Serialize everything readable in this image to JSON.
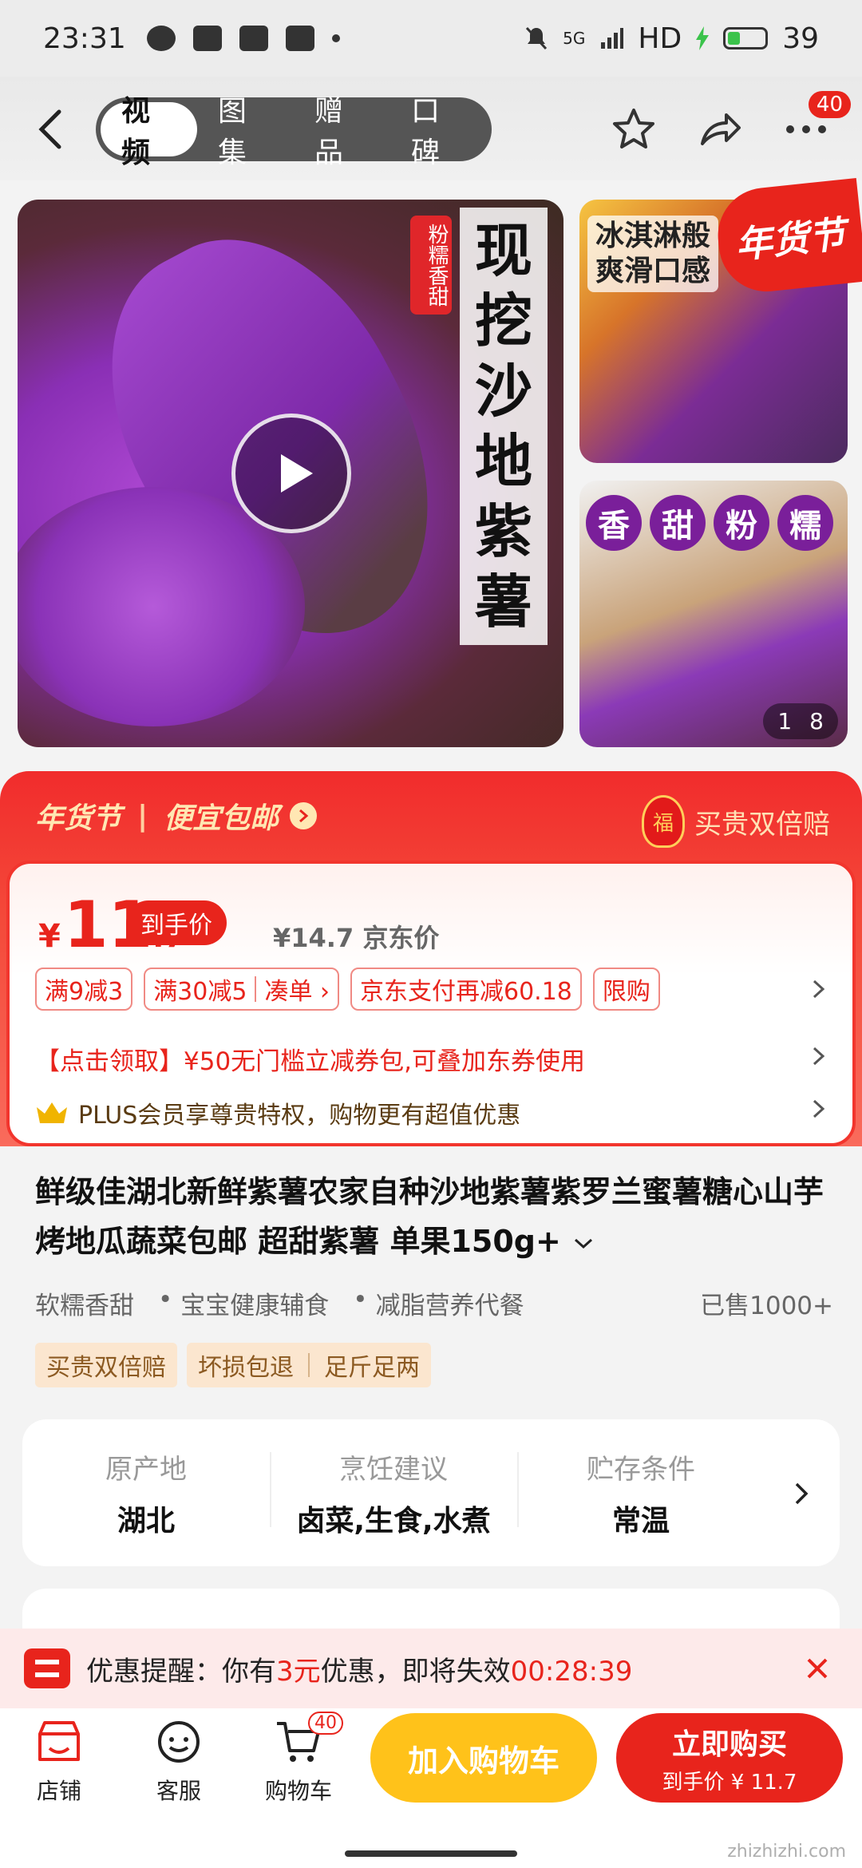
{
  "status_bar": {
    "time": "23:31",
    "network": "HD",
    "signal": "5G",
    "battery": "39"
  },
  "nav": {
    "tabs": [
      "视频",
      "图集",
      "赠品",
      "口碑"
    ],
    "badge": "40"
  },
  "gallery": {
    "main_vertical_text": [
      "现",
      "挖",
      "沙",
      "地",
      "紫",
      "薯"
    ],
    "main_badge": "粉糯香甜",
    "side1_caption_l1": "冰淇淋般",
    "side1_caption_l2": "爽滑口感",
    "side2_pills": [
      "香",
      "甜",
      "粉",
      "糯"
    ],
    "counter_current": "1",
    "counter_total": "8",
    "festival_tag": "年货节"
  },
  "promo": {
    "event": "年货节",
    "slogan": "便宜包邮",
    "guarantee": "买贵双倍赔",
    "lantern": "福"
  },
  "price": {
    "currency": "¥",
    "main": "11",
    "decimal": ".7",
    "tag": "到手价",
    "jd_price": "¥14.7 京东价",
    "coupons": [
      {
        "a": "满9减3"
      },
      {
        "a": "满30减5",
        "b": "凑单 ›"
      },
      {
        "a": "京东支付再减60.18"
      },
      {
        "a": "限购"
      }
    ],
    "coupon_line": "【点击领取】¥50无门槛立减券包,可叠加东券使用",
    "plus_line": "PLUS会员享尊贵特权，购物更有超值优惠"
  },
  "product": {
    "title": "鲜级佳湖北新鲜紫薯农家自种沙地紫薯紫罗兰蜜薯糖心山芋烤地瓜蔬菜包邮 超甜紫薯 单果150g+",
    "features": [
      "软糯香甜",
      "宝宝健康辅食",
      "减脂营养代餐"
    ],
    "sold": "已售1000+",
    "badge1": "买贵双倍赔",
    "badge2": "坏损包退",
    "badge3": "足斤足两"
  },
  "attributes": [
    {
      "k": "原产地",
      "v": "湖北"
    },
    {
      "k": "烹饪建议",
      "v": "卤菜,生食,水煮"
    },
    {
      "k": "贮存条件",
      "v": "常温"
    }
  ],
  "reminder": {
    "prefix": "优惠提醒：你有",
    "amount": "3元",
    "middle": "优惠，即将失效",
    "countdown": "00:28:39"
  },
  "bottom": {
    "shop": "店铺",
    "service": "客服",
    "cart": "购物车",
    "cart_badge": "40",
    "add_cart": "加入购物车",
    "buy": "立即购买",
    "buy_sub": "到手价 ¥ 11.7"
  },
  "watermark": "zhizhizhi.com",
  "colors": {
    "accent": "#e8241c",
    "cart_button": "#ffc21a",
    "badge_bg": "#fbe6cf"
  }
}
